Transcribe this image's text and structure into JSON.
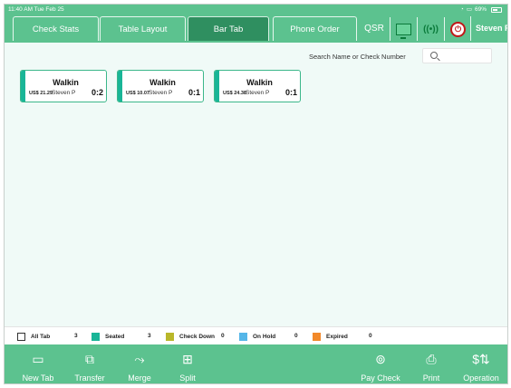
{
  "status_bar": {
    "time_date": "11:40 AM   Tue Feb 25",
    "battery": "69%"
  },
  "header": {
    "tabs": [
      {
        "label": "Check Stats",
        "active": false
      },
      {
        "label": "Table Layout",
        "active": false
      },
      {
        "label": "Bar Tab",
        "active": true
      },
      {
        "label": "Phone Order",
        "active": false
      }
    ],
    "qsr_label": "QSR",
    "icons": [
      "monitor-icon",
      "signal-icon",
      "power-icon"
    ],
    "user_name": "Steven P"
  },
  "search": {
    "label": "Search Name or Check Number",
    "value": "",
    "placeholder": ""
  },
  "tabs": [
    {
      "name": "Walkin",
      "amount": "US$ 21.29",
      "server": "Steven P",
      "count": "0:2"
    },
    {
      "name": "Walkin",
      "amount": "US$ 10.07",
      "server": "Steven P",
      "count": "0:1"
    },
    {
      "name": "Walkin",
      "amount": "US$ 24.38",
      "server": "Steven P",
      "count": "0:1"
    }
  ],
  "legend": [
    {
      "label": "All Tab",
      "count": "3",
      "color": "#ffffff"
    },
    {
      "label": "Seated",
      "count": "3",
      "color": "#19b597"
    },
    {
      "label": "Check Down",
      "count": "0",
      "color": "#b9b72a"
    },
    {
      "label": "On Hold",
      "count": "0",
      "color": "#55b6e8"
    },
    {
      "label": "Expired",
      "count": "0",
      "color": "#f2892a"
    }
  ],
  "toolbar": {
    "new_tab": "New Tab",
    "transfer": "Transfer",
    "merge": "Merge",
    "split": "Split",
    "pay_check": "Pay Check",
    "print": "Print",
    "operation": "Operation"
  },
  "colors": {
    "header_green": "#5cc28f",
    "active_tab": "#2f8f60",
    "card_border": "#3bb78a",
    "background": "#f0faf7"
  }
}
